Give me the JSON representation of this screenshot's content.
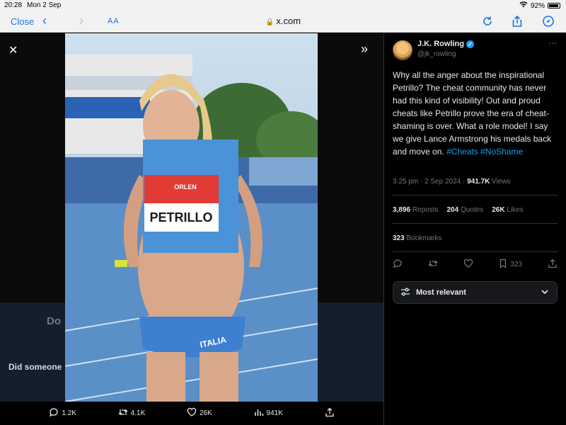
{
  "status_bar": {
    "time": "20:28",
    "date": "Mon 2 Sep",
    "battery": "92%",
    "battery_level": 0.92
  },
  "browser": {
    "close_label": "Close",
    "text_size_label": "AA",
    "url": "x.com"
  },
  "viewer": {
    "partial_headline": "Do",
    "partial_text": "Did someone",
    "actions": {
      "replies": "1.2K",
      "reposts": "4.1K",
      "likes": "26K",
      "views": "941K"
    },
    "photo": {
      "bib_text": "PETRILLO",
      "bib_brand": "ORLEN",
      "shorts_text": "ITALIA"
    }
  },
  "tweet": {
    "author_name": "J.K. Rowling",
    "handle": "@jk_rowling",
    "text_main": "Why all the anger about the inspirational Petrillo? The cheat community has never had this kind of visibility! Out and proud cheats like Petrillo prove the era of cheat-shaming is over. What a role model! I say we give Lance Armstrong his medals back and move on. ",
    "hashtag1": "#Cheats",
    "hashtag2": "#NoShame",
    "time": "3:25 pm",
    "date": "2 Sep 2024",
    "views_count": "941.7K",
    "views_label": "Views",
    "reposts_count": "3,896",
    "reposts_label": "Reposts",
    "quotes_count": "204",
    "quotes_label": "Quotes",
    "likes_count": "26K",
    "likes_label": "Likes",
    "bookmarks_count": "323",
    "bookmarks_label": "Bookmarks",
    "bookmark_icon_count": "323",
    "sort_label": "Most relevant"
  },
  "colors": {
    "accent": "#1d9bf0",
    "safari_blue": "#1a73e8",
    "track_blue": "#5b8fc7"
  }
}
